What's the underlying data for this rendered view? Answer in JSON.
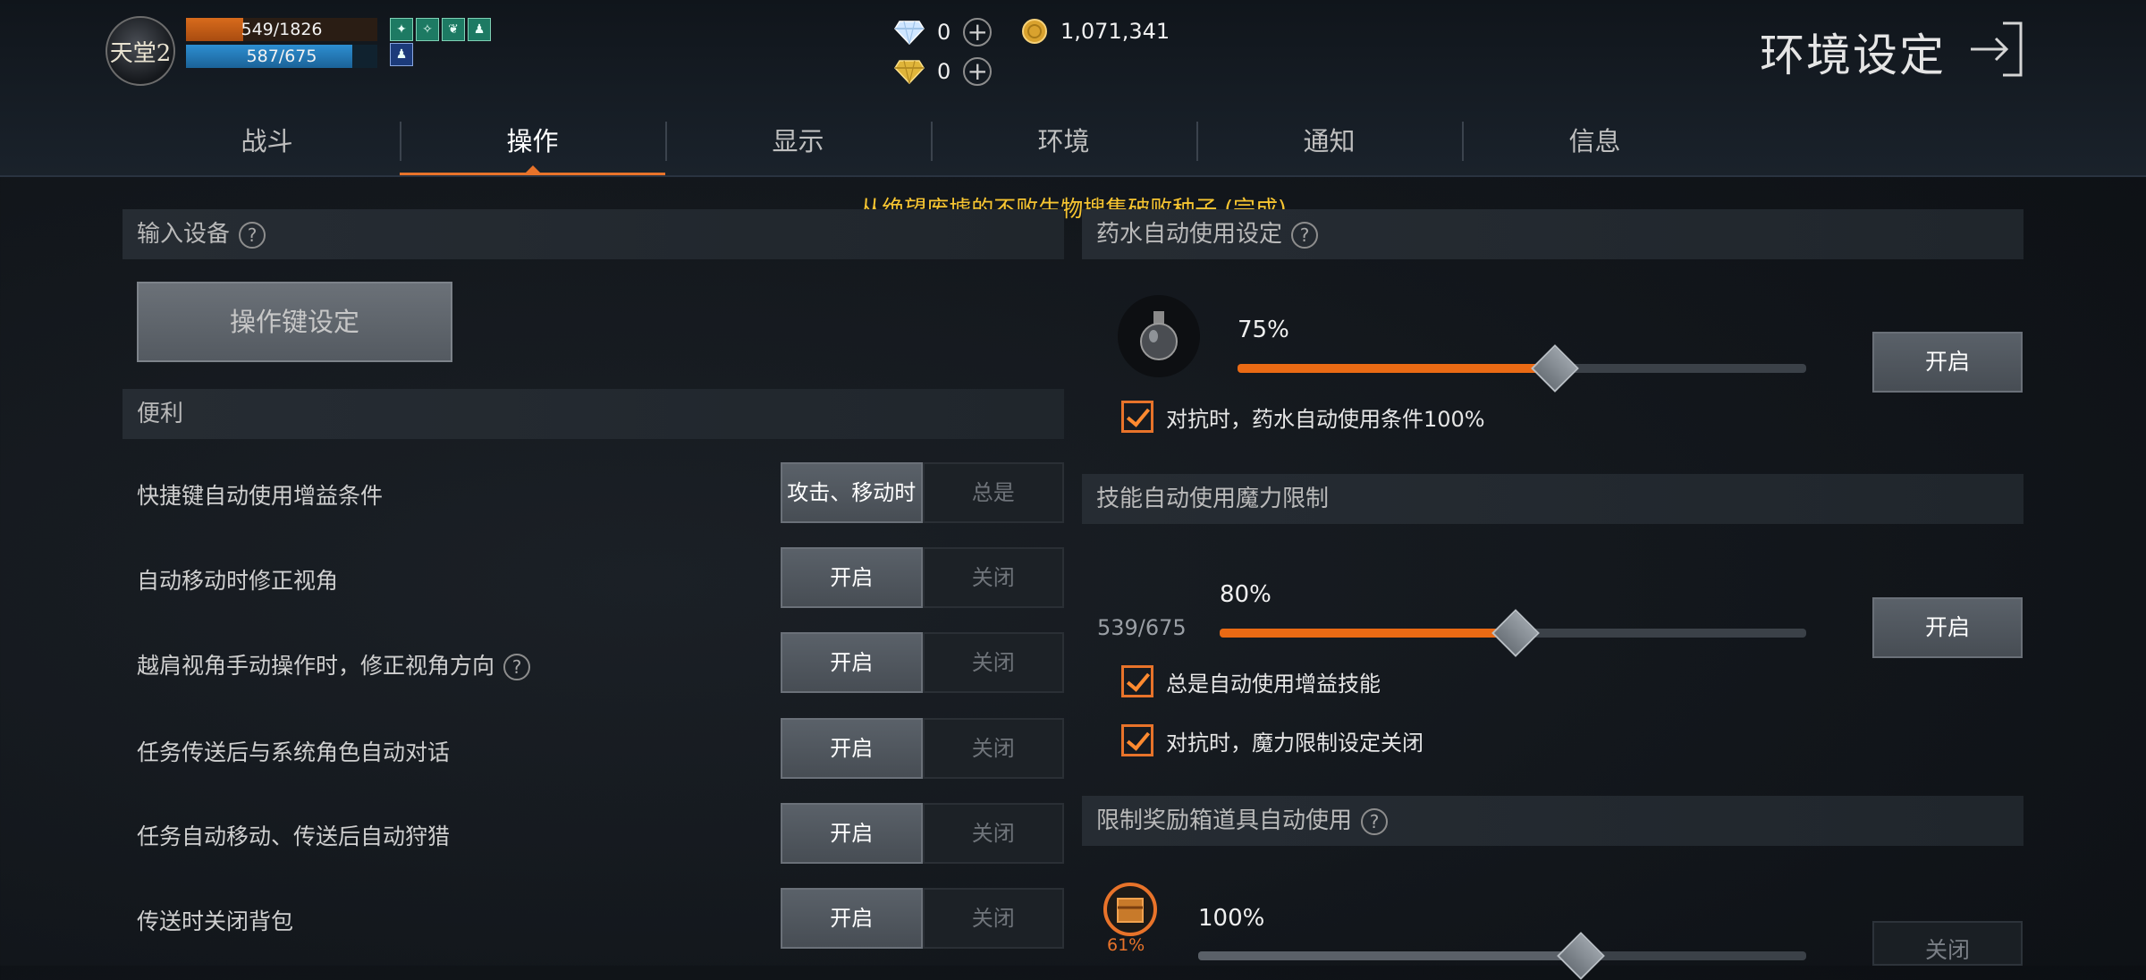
{
  "player": {
    "logo_text": "天堂2",
    "hp_text": "549/1826",
    "hp_ratio": 0.3,
    "mp_text": "587/675",
    "mp_ratio": 0.87,
    "buffs": [
      "风",
      "蛇",
      "叶",
      "人",
      "人"
    ]
  },
  "currency": {
    "diamond": "0",
    "gold_gem": "0",
    "adena": "1,071,341"
  },
  "header": {
    "title": "环境设定"
  },
  "tabs": [
    "战斗",
    "操作",
    "显示",
    "环境",
    "通知",
    "信息"
  ],
  "active_tab": 1,
  "notice": "从绝望废墟的不败生物搜集破败种子 (完成)",
  "left": {
    "input_section": "输入设备",
    "keybind_button": "操作键设定",
    "convenience_section": "便利",
    "rows": [
      {
        "label": "快捷键自动使用增益条件",
        "on": "攻击、移动时",
        "off": "总是",
        "help": false
      },
      {
        "label": "自动移动时修正视角",
        "on": "开启",
        "off": "关闭",
        "help": false
      },
      {
        "label": "越肩视角手动操作时，修正视角方向",
        "on": "开启",
        "off": "关闭",
        "help": true
      },
      {
        "label": "任务传送后与系统角色自动对话",
        "on": "开启",
        "off": "关闭",
        "help": false
      },
      {
        "label": "任务自动移动、传送后自动狩猎",
        "on": "开启",
        "off": "关闭",
        "help": false
      },
      {
        "label": "传送时关闭背包",
        "on": "开启",
        "off": "关闭",
        "help": false
      }
    ]
  },
  "right": {
    "potion": {
      "section": "药水自动使用设定",
      "percent_text": "75%",
      "value": 0.75,
      "button": "开启",
      "check": "对抗时，药水自动使用条件100%"
    },
    "mana": {
      "section": "技能自动使用魔力限制",
      "percent_text": "80%",
      "value": 0.8,
      "current": "539/675",
      "button": "开启",
      "check1": "总是自动使用增益技能",
      "check2": "对抗时，魔力限制设定关闭"
    },
    "box": {
      "section": "限制奖励箱道具自动使用",
      "item_pct": "61%",
      "percent_text": "100%",
      "value": 1.0,
      "button": "关闭"
    }
  }
}
